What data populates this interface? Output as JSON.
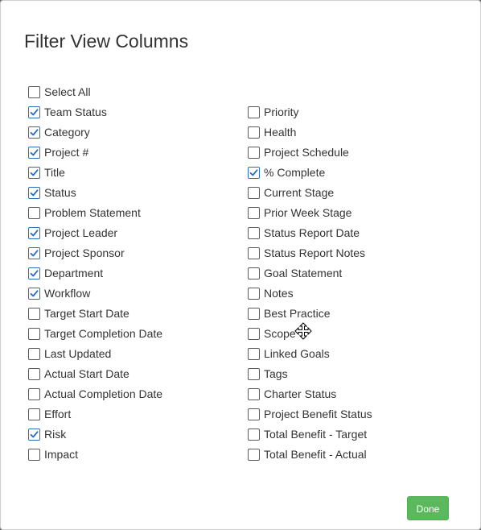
{
  "dialog": {
    "title": "Filter View Columns",
    "done_label": "Done",
    "accent_color": "#2a6dbd",
    "done_color": "#5cb85c"
  },
  "select_all": {
    "label": "Select All",
    "checked": false
  },
  "left_columns": [
    {
      "label": "Team Status",
      "checked": true
    },
    {
      "label": "Category",
      "checked": true
    },
    {
      "label": "Project #",
      "checked": true
    },
    {
      "label": "Title",
      "checked": true
    },
    {
      "label": "Status",
      "checked": true
    },
    {
      "label": "Problem Statement",
      "checked": false
    },
    {
      "label": "Project Leader",
      "checked": true
    },
    {
      "label": "Project Sponsor",
      "checked": true
    },
    {
      "label": "Department",
      "checked": true
    },
    {
      "label": "Workflow",
      "checked": true
    },
    {
      "label": "Target Start Date",
      "checked": false
    },
    {
      "label": "Target Completion Date",
      "checked": false
    },
    {
      "label": "Last Updated",
      "checked": false
    },
    {
      "label": "Actual Start Date",
      "checked": false
    },
    {
      "label": "Actual Completion Date",
      "checked": false
    },
    {
      "label": "Effort",
      "checked": false
    },
    {
      "label": "Risk",
      "checked": true
    },
    {
      "label": "Impact",
      "checked": false
    }
  ],
  "right_columns": [
    {
      "label": "Priority",
      "checked": false
    },
    {
      "label": "Health",
      "checked": false
    },
    {
      "label": "Project Schedule",
      "checked": false
    },
    {
      "label": "% Complete",
      "checked": true
    },
    {
      "label": "Current Stage",
      "checked": false
    },
    {
      "label": "Prior Week Stage",
      "checked": false
    },
    {
      "label": "Status Report Date",
      "checked": false
    },
    {
      "label": "Status Report Notes",
      "checked": false
    },
    {
      "label": "Goal Statement",
      "checked": false
    },
    {
      "label": "Notes",
      "checked": false
    },
    {
      "label": "Best Practice",
      "checked": false
    },
    {
      "label": "Scope",
      "checked": false
    },
    {
      "label": "Linked Goals",
      "checked": false
    },
    {
      "label": "Tags",
      "checked": false
    },
    {
      "label": "Charter Status",
      "checked": false
    },
    {
      "label": "Project Benefit Status",
      "checked": false
    },
    {
      "label": "Total Benefit - Target",
      "checked": false
    },
    {
      "label": "Total Benefit - Actual",
      "checked": false
    }
  ],
  "cursor": {
    "icon": "move-cursor-icon"
  }
}
